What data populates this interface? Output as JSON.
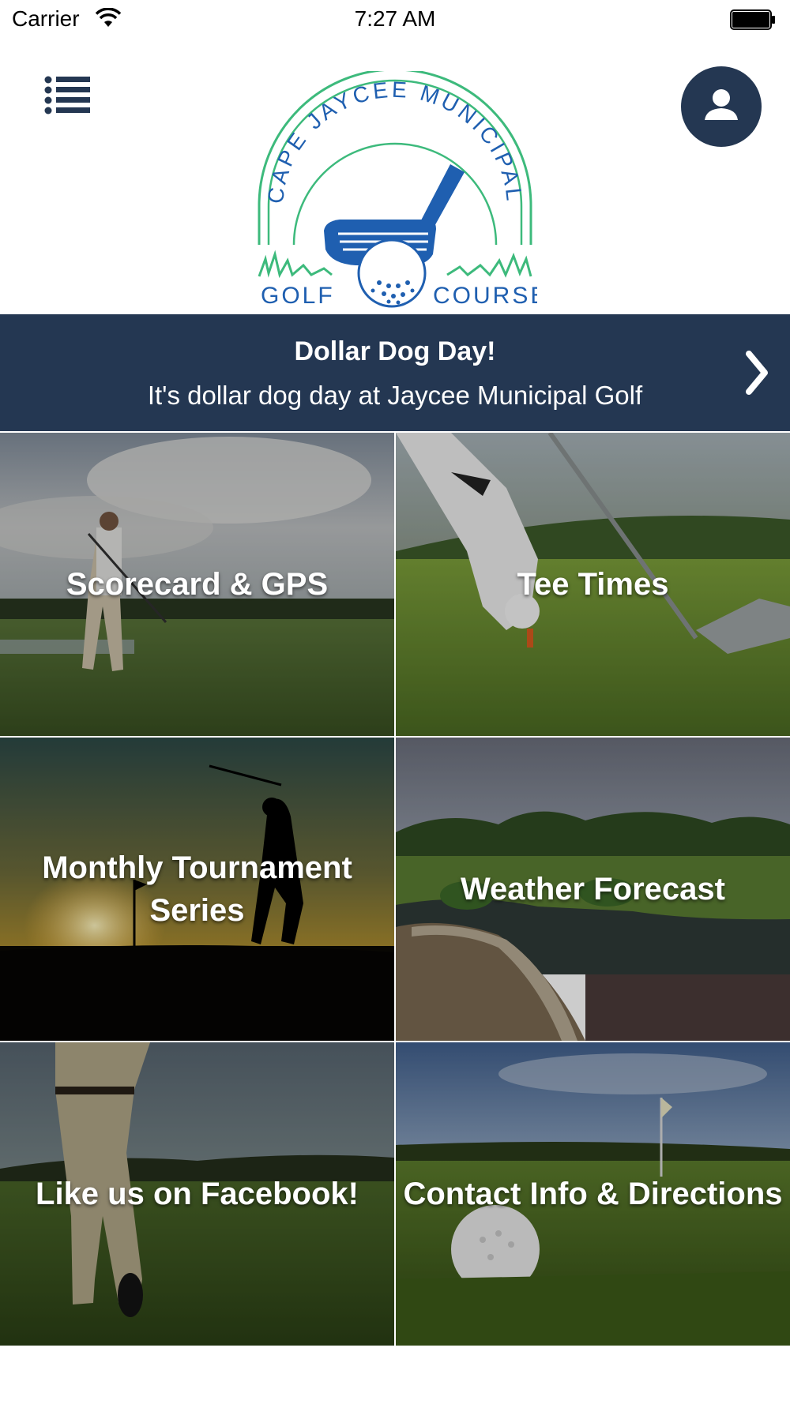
{
  "status_bar": {
    "carrier": "Carrier",
    "time": "7:27 AM",
    "icons": [
      "wifi-icon",
      "battery-icon"
    ]
  },
  "header": {
    "menu_icon": "list-menu-icon",
    "profile_icon": "user-icon",
    "logo": {
      "arc_text": "CAPE JAYCEE MUNICIPAL",
      "bottom_left": "GOLF",
      "bottom_right": "COURSE",
      "colors": {
        "arc": "#3dba7c",
        "club": "#1f5fb0",
        "text": "#1f5fb0"
      }
    }
  },
  "banner": {
    "title": "Dollar Dog Day!",
    "text": "It's dollar dog day at Jaycee Municipal Golf",
    "chevron_icon": "chevron-right-icon"
  },
  "tiles": [
    {
      "label": "Scorecard & GPS"
    },
    {
      "label": "Tee Times"
    },
    {
      "label": "Monthly Tournament Series"
    },
    {
      "label": "Weather Forecast"
    },
    {
      "label": "Like us on Facebook!"
    },
    {
      "label": "Contact Info & Directions"
    }
  ],
  "colors": {
    "navy": "#243752",
    "white": "#ffffff"
  }
}
